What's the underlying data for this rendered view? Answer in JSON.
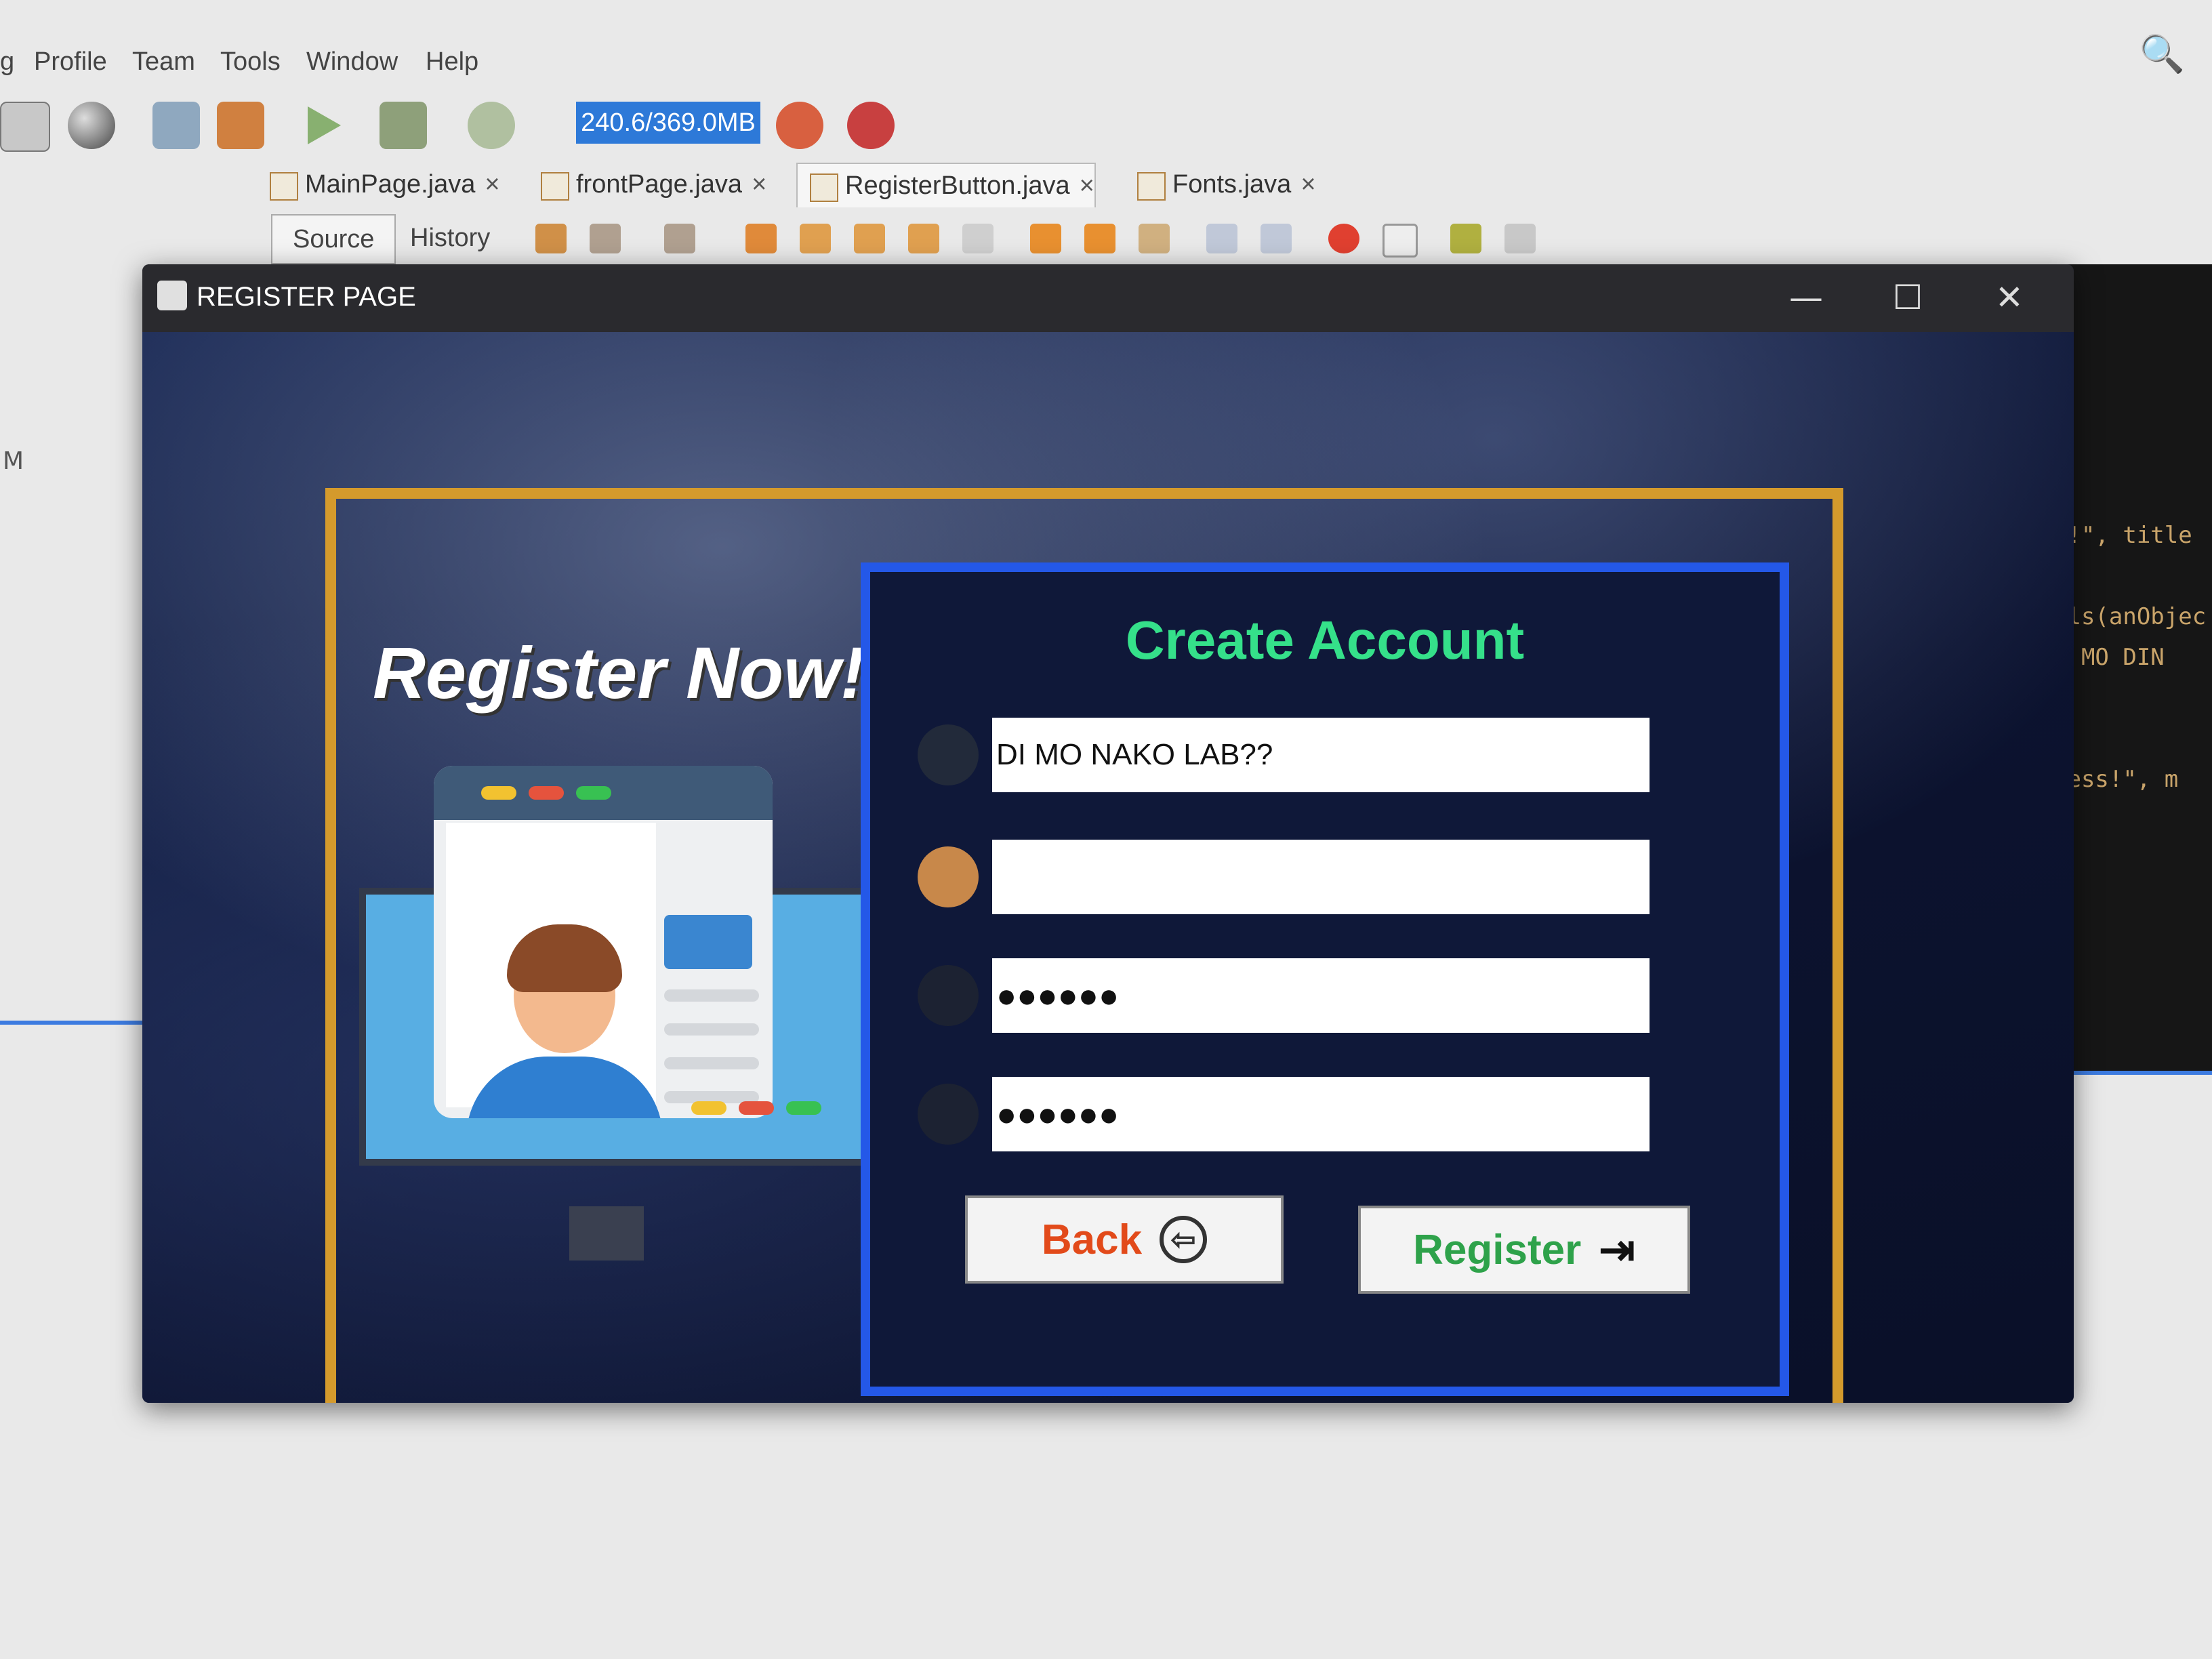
{
  "ide": {
    "menu": [
      "g",
      "Profile",
      "Team",
      "Tools",
      "Window",
      "Help"
    ],
    "memory": "240.6/369.0MB",
    "tabs": [
      {
        "label": "MainPage.java",
        "close": "×"
      },
      {
        "label": "frontPage.java",
        "close": "×"
      },
      {
        "label": "RegisterButton.java",
        "close": "×"
      },
      {
        "label": "Fonts.java",
        "close": "×"
      }
    ],
    "editor_tabs": {
      "source": "Source",
      "history": "History"
    },
    "side_letter": "M",
    "code_lines": [
      "n!\", title",
      "als(anObjec",
      "B MO DIN",
      "cess!\", m"
    ],
    "search_icon": "🔍"
  },
  "window": {
    "title": "REGISTER PAGE",
    "minimize": "—",
    "maximize": "☐",
    "close": "✕"
  },
  "left": {
    "heading": "Register Now!"
  },
  "form": {
    "title": "Create Account",
    "username_value": "DI MO NAKO LAB??",
    "email_value": "",
    "password_value": "●●●●●●",
    "confirm_value": "●●●●●●",
    "back_label": "Back",
    "back_icon": "⇦",
    "register_label": "Register",
    "register_icon": "⇥"
  },
  "colors": {
    "form_border": "#2458e8",
    "title_green": "#35e08a",
    "back_red": "#e24a1a",
    "register_green": "#2ea24a",
    "gold": "#d49a2c"
  }
}
